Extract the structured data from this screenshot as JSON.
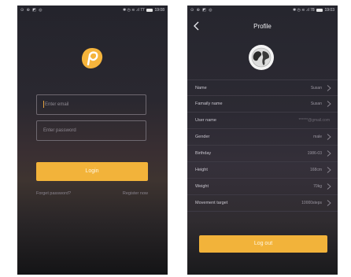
{
  "login": {
    "status": {
      "left_icons": "⊙ ⊕ ◩ ◎",
      "right": "✱ ◷ ≋ .ıl 77",
      "time": "19:08"
    },
    "email_placeholder": "Enter email",
    "password_placeholder": "Enter password",
    "login_label": "Login",
    "forgot_label": "Forget password?",
    "register_label": "Register now",
    "accent": "#f2b33a"
  },
  "profile": {
    "status": {
      "left_icons": "⊙ ⊕ ◩ ◎",
      "right": "✱ ◷ ≋ .ıl 78",
      "time": "19:03"
    },
    "title": "Profile",
    "rows": [
      {
        "label": "Name",
        "value": "Susan"
      },
      {
        "label": "Famaily name",
        "value": "Susan"
      },
      {
        "label": "User name",
        "value": "******@gmail.com"
      },
      {
        "label": "Gender",
        "value": "male"
      },
      {
        "label": "Birthday",
        "value": "1986-03"
      },
      {
        "label": "Height",
        "value": "168cm"
      },
      {
        "label": "Weight",
        "value": "70kg"
      },
      {
        "label": "Movement target",
        "value": "10000steps"
      }
    ],
    "logout_label": "Log out"
  }
}
